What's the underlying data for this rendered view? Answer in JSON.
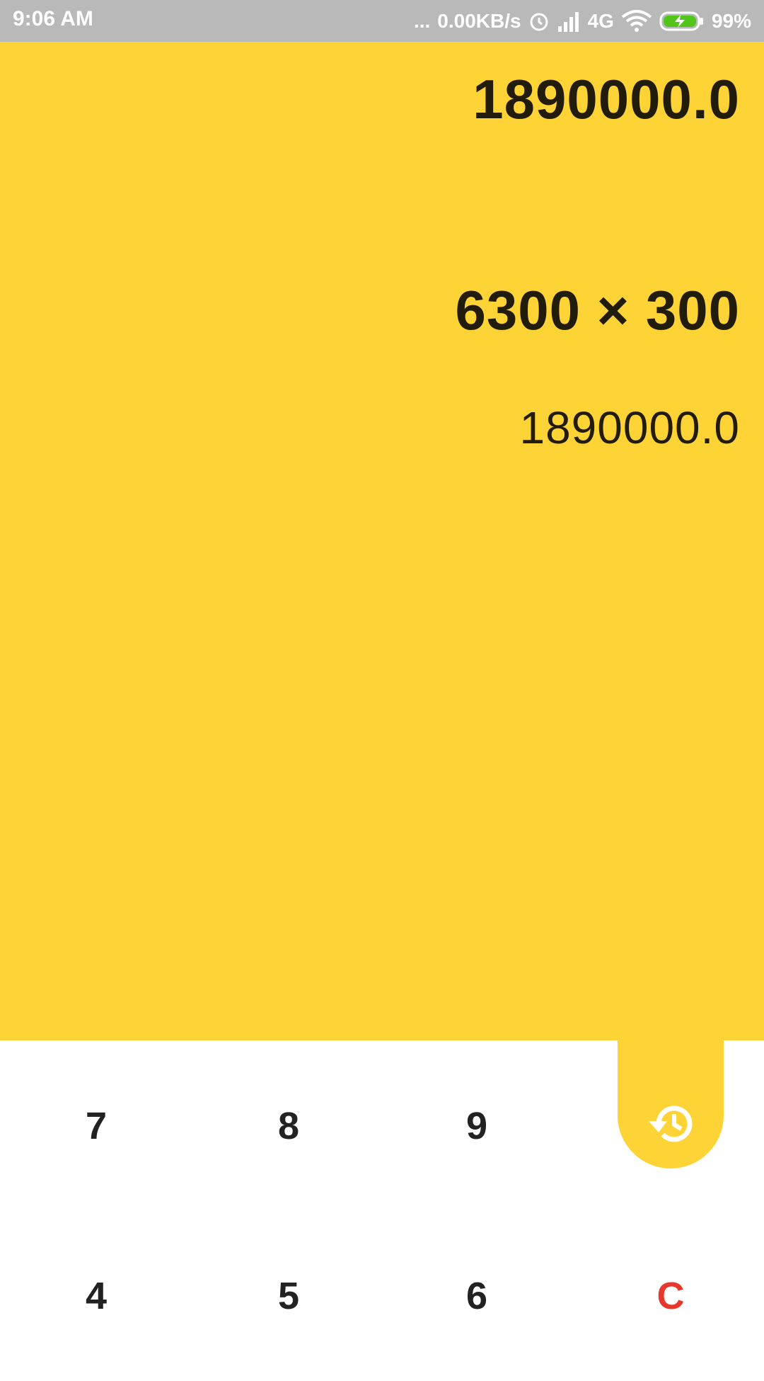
{
  "status_bar": {
    "time": "9:06 AM",
    "dots": "...",
    "network_speed": "0.00KB/s",
    "network_type": "4G",
    "battery_percent": "99%"
  },
  "display": {
    "current_value": "1890000.0",
    "history": {
      "expression": "6300 × 300",
      "result": "1890000.0"
    }
  },
  "keypad": {
    "row1": [
      "7",
      "8",
      "9"
    ],
    "row2": [
      "4",
      "5",
      "6"
    ],
    "clear_label": "C",
    "history_button_icon": "history-icon"
  },
  "colors": {
    "accent": "#fed335",
    "status_bar": "#b9b9b9",
    "clear": "#e8372c",
    "text": "#222222"
  }
}
